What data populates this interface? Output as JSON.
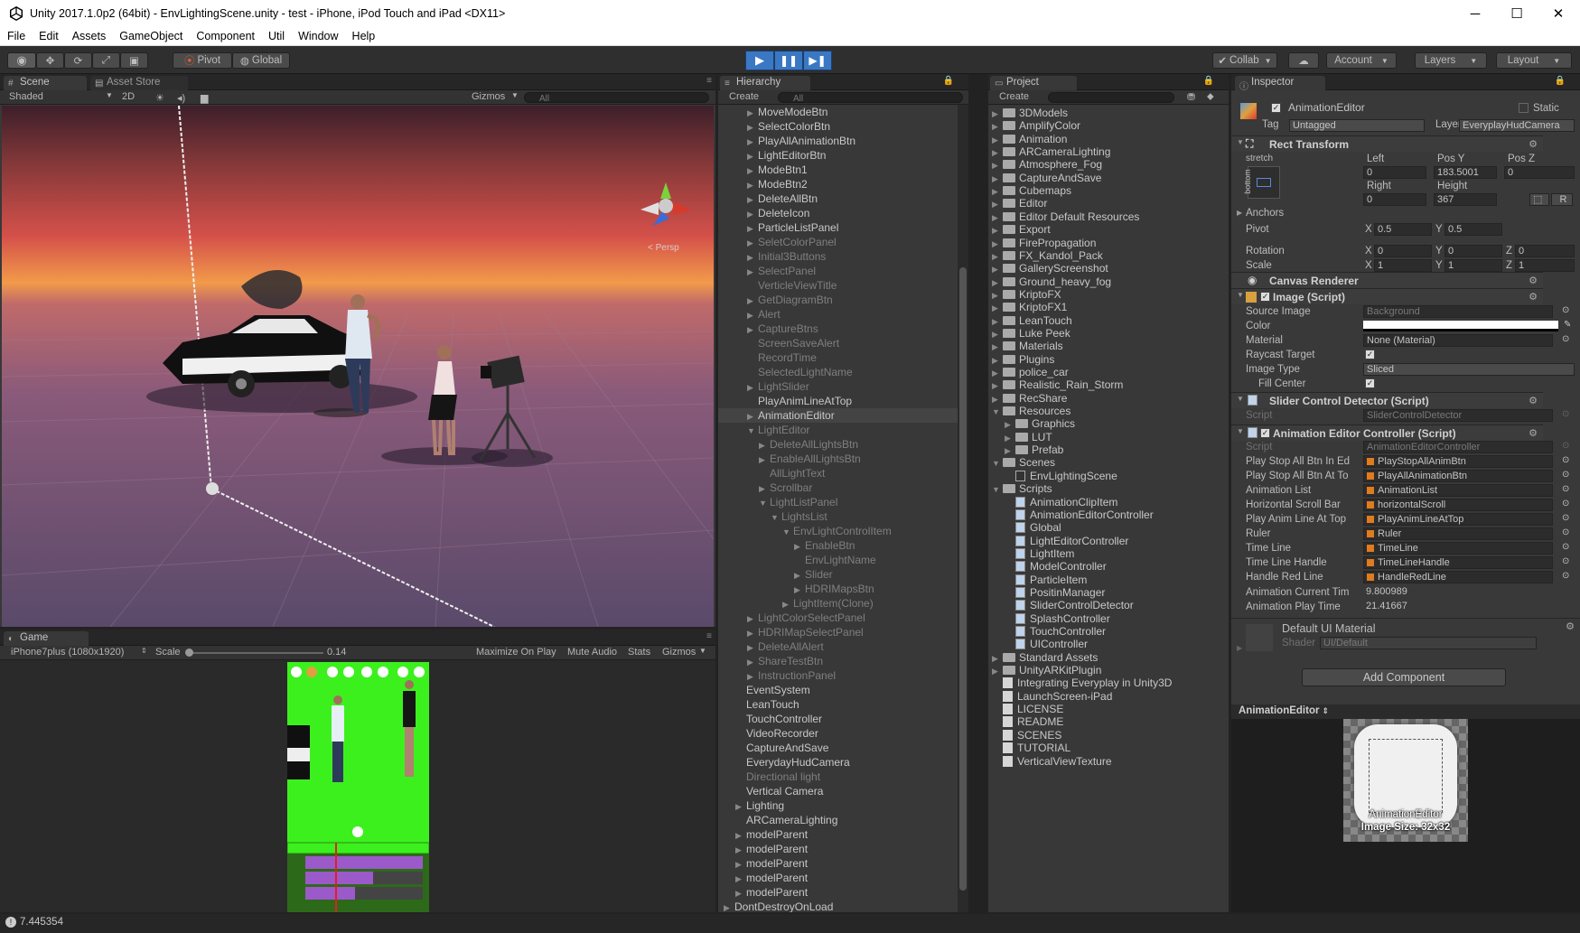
{
  "window": {
    "title": "Unity 2017.1.0p2 (64bit) - EnvLightingScene.unity - test - iPhone, iPod Touch and iPad <DX11>",
    "minimize": "─",
    "maximize": "☐",
    "close": "✕"
  },
  "menu": [
    "File",
    "Edit",
    "Assets",
    "GameObject",
    "Component",
    "Util",
    "Window",
    "Help"
  ],
  "toolbar": {
    "pivot": "Pivot",
    "global": "Global",
    "collab": "Collab",
    "account": "Account",
    "layers": "Layers",
    "layout": "Layout"
  },
  "scene": {
    "tab": "Scene",
    "asset_store_tab": "Asset Store",
    "shading": "Shaded",
    "mode_2d": "2D",
    "gizmos": "Gizmos",
    "search": "All",
    "persp_label": "< Persp",
    "colors": {
      "sky_top": "#3d1f2a",
      "sky_mid": "#d4504a",
      "horizon": "#f29a4a",
      "ground": "#5a4a6a"
    }
  },
  "game": {
    "tab": "Game",
    "resolution": "iPhone7plus (1080x1920)",
    "scale_label": "Scale",
    "scale_value": "0.14",
    "maximize": "Maximize On Play",
    "mute": "Mute Audio",
    "stats": "Stats",
    "gizmos": "Gizmos",
    "screen_bg": "#3cf01e",
    "timeline_bar": "#9b59c9"
  },
  "hierarchy": {
    "tab": "Hierarchy",
    "create": "Create",
    "search": "All",
    "items": [
      {
        "label": "MoveModeBtn",
        "indent": 2,
        "arrow": true,
        "dim": false
      },
      {
        "label": "SelectColorBtn",
        "indent": 2,
        "arrow": true,
        "dim": false
      },
      {
        "label": "PlayAllAnimationBtn",
        "indent": 2,
        "arrow": true,
        "dim": false
      },
      {
        "label": "LightEditorBtn",
        "indent": 2,
        "arrow": true,
        "dim": false
      },
      {
        "label": "ModeBtn1",
        "indent": 2,
        "arrow": true,
        "dim": false
      },
      {
        "label": "ModeBtn2",
        "indent": 2,
        "arrow": true,
        "dim": false
      },
      {
        "label": "DeleteAllBtn",
        "indent": 2,
        "arrow": true,
        "dim": false
      },
      {
        "label": "DeleteIcon",
        "indent": 2,
        "arrow": true,
        "dim": false
      },
      {
        "label": "ParticleListPanel",
        "indent": 2,
        "arrow": true,
        "dim": false
      },
      {
        "label": "SeletColorPanel",
        "indent": 2,
        "arrow": true,
        "dim": true
      },
      {
        "label": "Initial3Buttons",
        "indent": 2,
        "arrow": true,
        "dim": true
      },
      {
        "label": "SelectPanel",
        "indent": 2,
        "arrow": true,
        "dim": true
      },
      {
        "label": "VerticleViewTitle",
        "indent": 2,
        "arrow": false,
        "dim": true
      },
      {
        "label": "GetDiagramBtn",
        "indent": 2,
        "arrow": true,
        "dim": true
      },
      {
        "label": "Alert",
        "indent": 2,
        "arrow": true,
        "dim": true
      },
      {
        "label": "CaptureBtns",
        "indent": 2,
        "arrow": true,
        "dim": true
      },
      {
        "label": "ScreenSaveAlert",
        "indent": 2,
        "arrow": false,
        "dim": true
      },
      {
        "label": "RecordTime",
        "indent": 2,
        "arrow": false,
        "dim": true
      },
      {
        "label": "SelectedLightName",
        "indent": 2,
        "arrow": false,
        "dim": true
      },
      {
        "label": "LightSlider",
        "indent": 2,
        "arrow": true,
        "dim": true
      },
      {
        "label": "PlayAnimLineAtTop",
        "indent": 2,
        "arrow": false,
        "dim": false
      },
      {
        "label": "AnimationEditor",
        "indent": 2,
        "arrow": true,
        "dim": false,
        "selected": true
      },
      {
        "label": "LightEditor",
        "indent": 2,
        "arrow": true,
        "open": true,
        "dim": true
      },
      {
        "label": "DeleteAllLightsBtn",
        "indent": 3,
        "arrow": true,
        "dim": true
      },
      {
        "label": "EnableAllLightsBtn",
        "indent": 3,
        "arrow": true,
        "dim": true
      },
      {
        "label": "AllLightText",
        "indent": 3,
        "arrow": false,
        "dim": true
      },
      {
        "label": "Scrollbar",
        "indent": 3,
        "arrow": true,
        "dim": true
      },
      {
        "label": "LightListPanel",
        "indent": 3,
        "arrow": true,
        "open": true,
        "dim": true
      },
      {
        "label": "LightsList",
        "indent": 4,
        "arrow": true,
        "open": true,
        "dim": true
      },
      {
        "label": "EnvLightControlItem",
        "indent": 5,
        "arrow": true,
        "open": true,
        "dim": true
      },
      {
        "label": "EnableBtn",
        "indent": 6,
        "arrow": true,
        "dim": true
      },
      {
        "label": "EnvLightName",
        "indent": 6,
        "arrow": false,
        "dim": true
      },
      {
        "label": "Slider",
        "indent": 6,
        "arrow": true,
        "dim": true
      },
      {
        "label": "HDRIMapsBtn",
        "indent": 6,
        "arrow": true,
        "dim": true
      },
      {
        "label": "LightItem(Clone)",
        "indent": 5,
        "arrow": true,
        "dim": true
      },
      {
        "label": "LightColorSelectPanel",
        "indent": 2,
        "arrow": true,
        "dim": true
      },
      {
        "label": "HDRIMapSelectPanel",
        "indent": 2,
        "arrow": true,
        "dim": true
      },
      {
        "label": "DeleteAllAlert",
        "indent": 2,
        "arrow": true,
        "dim": true
      },
      {
        "label": "ShareTestBtn",
        "indent": 2,
        "arrow": true,
        "dim": true
      },
      {
        "label": "InstructionPanel",
        "indent": 2,
        "arrow": true,
        "dim": true
      },
      {
        "label": "EventSystem",
        "indent": 1,
        "arrow": false,
        "dim": false
      },
      {
        "label": "LeanTouch",
        "indent": 1,
        "arrow": false,
        "dim": false
      },
      {
        "label": "TouchController",
        "indent": 1,
        "arrow": false,
        "dim": false
      },
      {
        "label": "VideoRecorder",
        "indent": 1,
        "arrow": false,
        "dim": false
      },
      {
        "label": "CaptureAndSave",
        "indent": 1,
        "arrow": false,
        "dim": false
      },
      {
        "label": "EverydayHudCamera",
        "indent": 1,
        "arrow": false,
        "dim": false
      },
      {
        "label": "Directional light",
        "indent": 1,
        "arrow": false,
        "dim": true
      },
      {
        "label": "Vertical Camera",
        "indent": 1,
        "arrow": false,
        "dim": false
      },
      {
        "label": "Lighting",
        "indent": 1,
        "arrow": true,
        "dim": false
      },
      {
        "label": "ARCameraLighting",
        "indent": 1,
        "arrow": false,
        "dim": false
      },
      {
        "label": "modelParent",
        "indent": 1,
        "arrow": true,
        "dim": false
      },
      {
        "label": "modelParent",
        "indent": 1,
        "arrow": true,
        "dim": false
      },
      {
        "label": "modelParent",
        "indent": 1,
        "arrow": true,
        "dim": false
      },
      {
        "label": "modelParent",
        "indent": 1,
        "arrow": true,
        "dim": false
      },
      {
        "label": "modelParent",
        "indent": 1,
        "arrow": true,
        "dim": false
      },
      {
        "label": "DontDestroyOnLoad",
        "indent": 0,
        "arrow": true,
        "dim": false
      }
    ]
  },
  "project": {
    "tab": "Project",
    "create": "Create",
    "items": [
      {
        "label": "3DModels",
        "indent": 0,
        "type": "folder",
        "arrow": true
      },
      {
        "label": "AmplifyColor",
        "indent": 0,
        "type": "folder",
        "arrow": true
      },
      {
        "label": "Animation",
        "indent": 0,
        "type": "folder",
        "arrow": true
      },
      {
        "label": "ARCameraLighting",
        "indent": 0,
        "type": "folder",
        "arrow": true
      },
      {
        "label": "Atmosphere_Fog",
        "indent": 0,
        "type": "folder",
        "arrow": true
      },
      {
        "label": "CaptureAndSave",
        "indent": 0,
        "type": "folder",
        "arrow": true
      },
      {
        "label": "Cubemaps",
        "indent": 0,
        "type": "folder",
        "arrow": true
      },
      {
        "label": "Editor",
        "indent": 0,
        "type": "folder",
        "arrow": true
      },
      {
        "label": "Editor Default Resources",
        "indent": 0,
        "type": "folder",
        "arrow": true
      },
      {
        "label": "Export",
        "indent": 0,
        "type": "folder",
        "arrow": true
      },
      {
        "label": "FirePropagation",
        "indent": 0,
        "type": "folder",
        "arrow": true
      },
      {
        "label": "FX_Kandol_Pack",
        "indent": 0,
        "type": "folder",
        "arrow": true
      },
      {
        "label": "GalleryScreenshot",
        "indent": 0,
        "type": "folder",
        "arrow": true
      },
      {
        "label": "Ground_heavy_fog",
        "indent": 0,
        "type": "folder",
        "arrow": true
      },
      {
        "label": "KriptoFX",
        "indent": 0,
        "type": "folder",
        "arrow": true
      },
      {
        "label": "KriptoFX1",
        "indent": 0,
        "type": "folder",
        "arrow": true
      },
      {
        "label": "LeanTouch",
        "indent": 0,
        "type": "folder",
        "arrow": true
      },
      {
        "label": "Luke Peek",
        "indent": 0,
        "type": "folder",
        "arrow": true
      },
      {
        "label": "Materials",
        "indent": 0,
        "type": "folder",
        "arrow": true
      },
      {
        "label": "Plugins",
        "indent": 0,
        "type": "folder",
        "arrow": true
      },
      {
        "label": "police_car",
        "indent": 0,
        "type": "folder",
        "arrow": true
      },
      {
        "label": "Realistic_Rain_Storm",
        "indent": 0,
        "type": "folder",
        "arrow": true
      },
      {
        "label": "RecShare",
        "indent": 0,
        "type": "folder",
        "arrow": true
      },
      {
        "label": "Resources",
        "indent": 0,
        "type": "folder",
        "arrow": true,
        "open": true
      },
      {
        "label": "Graphics",
        "indent": 1,
        "type": "folder",
        "arrow": true
      },
      {
        "label": "LUT",
        "indent": 1,
        "type": "folder",
        "arrow": true
      },
      {
        "label": "Prefab",
        "indent": 1,
        "type": "folder",
        "arrow": true
      },
      {
        "label": "Scenes",
        "indent": 0,
        "type": "folder",
        "arrow": true,
        "open": true
      },
      {
        "label": "EnvLightingScene",
        "indent": 1,
        "type": "scene",
        "arrow": false
      },
      {
        "label": "Scripts",
        "indent": 0,
        "type": "folder",
        "arrow": true,
        "open": true
      },
      {
        "label": "AnimationClipItem",
        "indent": 1,
        "type": "script",
        "arrow": false
      },
      {
        "label": "AnimationEditorController",
        "indent": 1,
        "type": "script",
        "arrow": false
      },
      {
        "label": "Global",
        "indent": 1,
        "type": "script",
        "arrow": false
      },
      {
        "label": "LightEditorController",
        "indent": 1,
        "type": "script",
        "arrow": false
      },
      {
        "label": "LightItem",
        "indent": 1,
        "type": "script",
        "arrow": false
      },
      {
        "label": "ModelController",
        "indent": 1,
        "type": "script",
        "arrow": false
      },
      {
        "label": "ParticleItem",
        "indent": 1,
        "type": "script",
        "arrow": false
      },
      {
        "label": "PositinManager",
        "indent": 1,
        "type": "script",
        "arrow": false
      },
      {
        "label": "SliderControlDetector",
        "indent": 1,
        "type": "script",
        "arrow": false
      },
      {
        "label": "SplashController",
        "indent": 1,
        "type": "script",
        "arrow": false
      },
      {
        "label": "TouchController",
        "indent": 1,
        "type": "script",
        "arrow": false
      },
      {
        "label": "UIController",
        "indent": 1,
        "type": "script",
        "arrow": false
      },
      {
        "label": "Standard Assets",
        "indent": 0,
        "type": "folder",
        "arrow": true
      },
      {
        "label": "UnityARKitPlugin",
        "indent": 0,
        "type": "folder",
        "arrow": true
      },
      {
        "label": "Integrating Everyplay in Unity3D",
        "indent": 0,
        "type": "file",
        "arrow": false
      },
      {
        "label": "LaunchScreen-iPad",
        "indent": 0,
        "type": "file",
        "arrow": false
      },
      {
        "label": "LICENSE",
        "indent": 0,
        "type": "file",
        "arrow": false
      },
      {
        "label": "README",
        "indent": 0,
        "type": "file",
        "arrow": false
      },
      {
        "label": "SCENES",
        "indent": 0,
        "type": "file",
        "arrow": false
      },
      {
        "label": "TUTORIAL",
        "indent": 0,
        "type": "file",
        "arrow": false
      },
      {
        "label": "VerticalViewTexture",
        "indent": 0,
        "type": "file",
        "arrow": false
      }
    ]
  },
  "inspector": {
    "tab": "Inspector",
    "name": "AnimationEditor",
    "static": "Static",
    "tag_label": "Tag",
    "tag": "Untagged",
    "layer_label": "Layer",
    "layer": "EveryplayHudCamera",
    "rect_transform": "Rect Transform",
    "stretch": "stretch",
    "bottom": "bottom",
    "left_label": "Left",
    "posy_label": "Pos Y",
    "posz_label": "Pos Z",
    "left": "0",
    "posy": "183.5001",
    "posz": "0",
    "right_label": "Right",
    "height_label": "Height",
    "right": "0",
    "height": "367",
    "anchors": "Anchors",
    "pivot_label": "Pivot",
    "pivot_x": "0.5",
    "pivot_y": "0.5",
    "rotation_label": "Rotation",
    "rot_x": "0",
    "rot_y": "0",
    "rot_z": "0",
    "scale_label": "Scale",
    "scale_x": "1",
    "scale_y": "1",
    "scale_z": "1",
    "x": "X",
    "y": "Y",
    "z": "Z",
    "r_btn": "R",
    "canvas_renderer": "Canvas Renderer",
    "image_script": "Image (Script)",
    "source_image_label": "Source Image",
    "source_image": "Background",
    "color_label": "Color",
    "material_label": "Material",
    "material": "None (Material)",
    "raycast_label": "Raycast Target",
    "image_type_label": "Image Type",
    "image_type": "Sliced",
    "fill_center_label": "Fill Center",
    "slider_detector": "Slider Control Detector (Script)",
    "script_label": "Script",
    "slider_script": "SliderControlDetector",
    "anim_ctrl": "Animation Editor Controller (Script)",
    "anim_script": "AnimationEditorController",
    "fields": [
      {
        "label": "Play Stop All Btn In Ed",
        "value": "PlayStopAllAnimBtn"
      },
      {
        "label": "Play Stop All Btn At To",
        "value": "PlayAllAnimationBtn"
      },
      {
        "label": "Animation List",
        "value": "AnimationList"
      },
      {
        "label": "Horizontal Scroll Bar",
        "value": "horizontalScroll"
      },
      {
        "label": "Play Anim Line At Top",
        "value": "PlayAnimLineAtTop"
      },
      {
        "label": "Ruler",
        "value": "Ruler"
      },
      {
        "label": "Time Line",
        "value": "TimeLine"
      },
      {
        "label": "Time Line Handle",
        "value": "TimeLineHandle"
      },
      {
        "label": "Handle Red Line",
        "value": "HandleRedLine"
      }
    ],
    "current_time_label": "Animation Current Tim",
    "current_time": "9.800989",
    "play_time_label": "Animation Play Time",
    "play_time": "21.41667",
    "default_material": "Default UI Material",
    "shader_label": "Shader",
    "shader": "UI/Default",
    "add_component": "Add Component",
    "preview_title": "AnimationEditor",
    "preview_name": "AnimationEditor",
    "preview_size": "Image Size: 32x32"
  },
  "status": {
    "text": "7.445354"
  }
}
